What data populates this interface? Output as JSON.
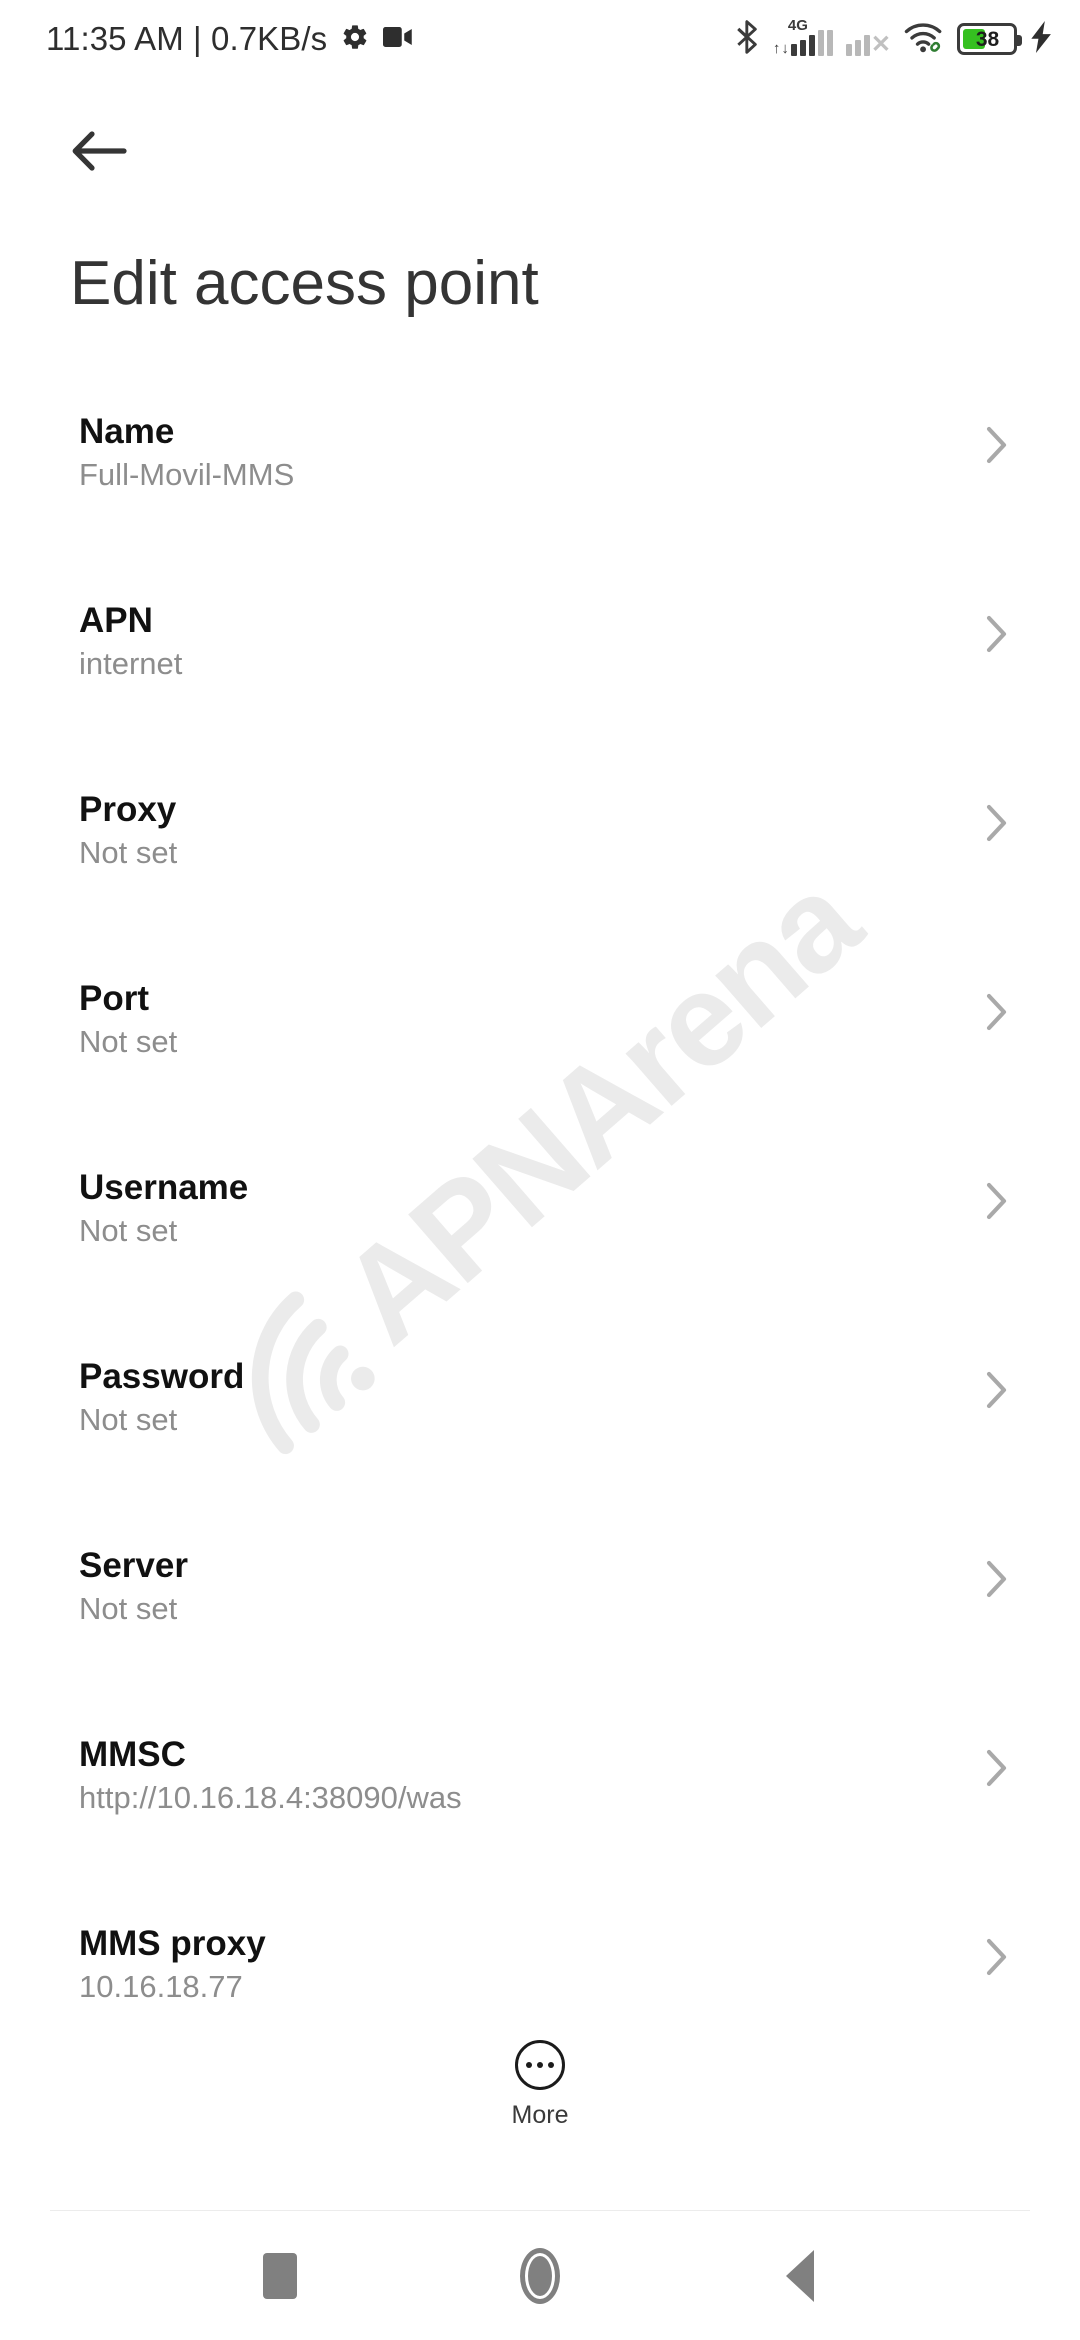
{
  "status_bar": {
    "clock": "11:35 AM | 0.7KB/s",
    "gear_icon": "gear-icon",
    "video_icon": "video-camera-icon",
    "bluetooth_icon": "bluetooth-icon",
    "network_type": "4G",
    "wifi_icon": "wifi-icon",
    "battery_percent": "38",
    "charging_icon": "charging-bolt-icon",
    "battery_fill_color": "#35c020"
  },
  "header": {
    "back_icon": "back-arrow-icon",
    "title": "Edit access point"
  },
  "watermark": {
    "text": "APNArena",
    "color": "#ebebeb"
  },
  "list": {
    "rows": [
      {
        "title": "Name",
        "value": "Full-Movil-MMS"
      },
      {
        "title": "APN",
        "value": "internet"
      },
      {
        "title": "Proxy",
        "value": "Not set"
      },
      {
        "title": "Port",
        "value": "Not set"
      },
      {
        "title": "Username",
        "value": "Not set"
      },
      {
        "title": "Password",
        "value": "Not set"
      },
      {
        "title": "Server",
        "value": "Not set"
      },
      {
        "title": "MMSC",
        "value": "http://10.16.18.4:38090/was"
      },
      {
        "title": "MMS proxy",
        "value": "10.16.18.77"
      }
    ]
  },
  "more": {
    "label": "More",
    "icon": "overflow-dots-icon"
  },
  "nav_bar": {
    "recents": "recents-square-icon",
    "home": "home-circle-icon",
    "back": "back-triangle-icon"
  }
}
